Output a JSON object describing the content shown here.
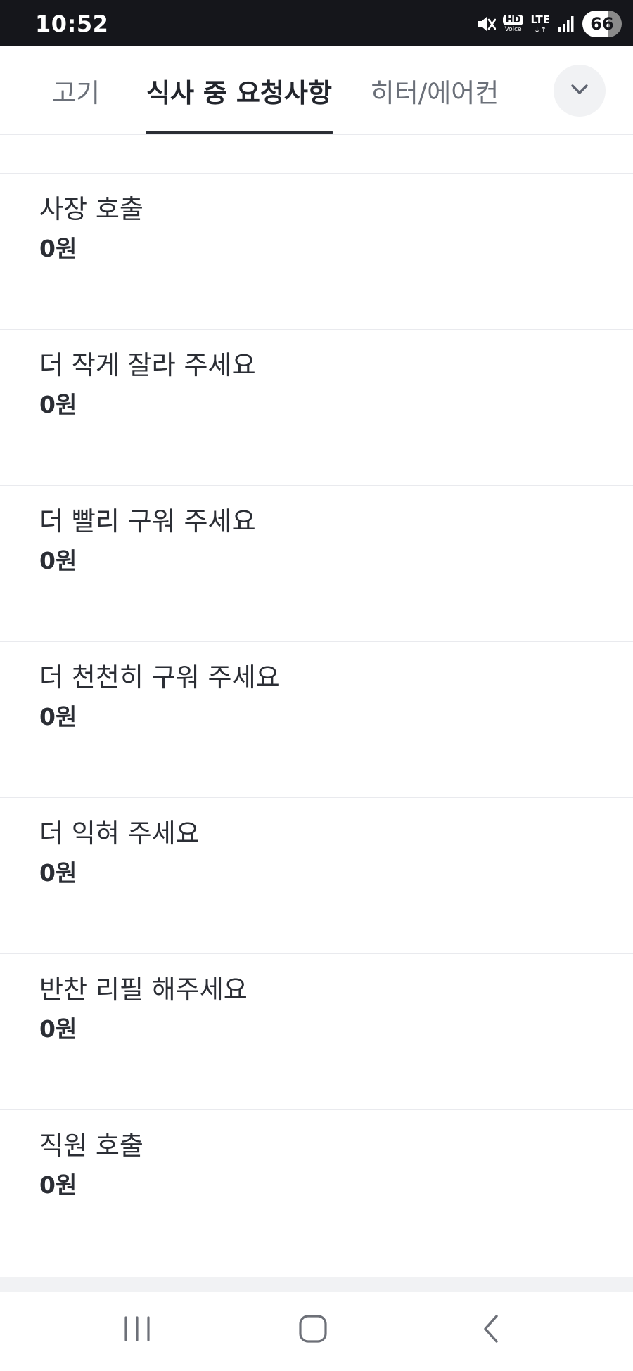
{
  "status_bar": {
    "time": "10:52",
    "hd": "HD",
    "voice": "Voice",
    "network": "LTE",
    "network_arrows": "↓↑",
    "battery": "66"
  },
  "tabs": [
    {
      "label": "고기",
      "active": false
    },
    {
      "label": "식사 중 요청사항",
      "active": true
    },
    {
      "label": "히터/에어컨",
      "active": false
    }
  ],
  "items": [
    {
      "name": "사장 호출",
      "price": "0원"
    },
    {
      "name": "더 작게 잘라 주세요",
      "price": "0원"
    },
    {
      "name": "더 빨리 구워 주세요",
      "price": "0원"
    },
    {
      "name": "더 천천히 구워 주세요",
      "price": "0원"
    },
    {
      "name": "더 익혀 주세요",
      "price": "0원"
    },
    {
      "name": "반찬 리필 해주세요",
      "price": "0원"
    },
    {
      "name": "직원 호출",
      "price": "0원"
    }
  ],
  "icons": {
    "expand": "chevron-down-icon",
    "mute": "mute-icon",
    "signal": "signal-icon",
    "recents": "recents-icon",
    "home": "home-icon",
    "back": "back-icon"
  },
  "colors": {
    "status_bar": "#15161b",
    "active_tab": "#23262d",
    "inactive_tab": "#6b7079",
    "divider": "#e9eaee"
  }
}
